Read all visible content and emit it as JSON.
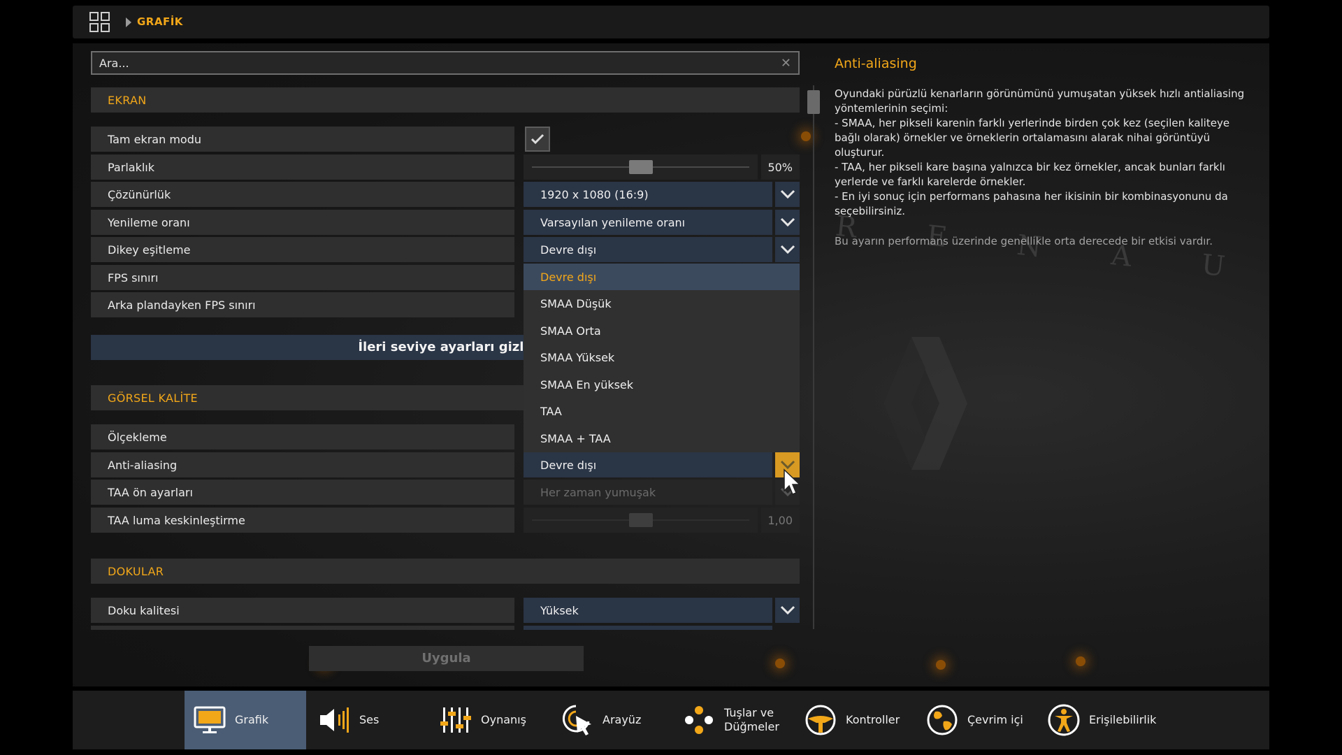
{
  "breadcrumb": {
    "current": "GRAFİK"
  },
  "search": {
    "placeholder": "Ara..."
  },
  "sections": {
    "ekran": "EKRAN",
    "gorsel": "GÖRSEL KALİTE",
    "dokular": "DOKULAR"
  },
  "settings": {
    "fullscreen": {
      "label": "Tam ekran modu",
      "checked": true
    },
    "brightness": {
      "label": "Parlaklık",
      "value": "50%"
    },
    "resolution": {
      "label": "Çözünürlük",
      "value": "1920 x 1080 (16:9)"
    },
    "refresh": {
      "label": "Yenileme oranı",
      "value": "Varsayılan yenileme oranı"
    },
    "vsync": {
      "label": "Dikey eşitleme",
      "value": "Devre dışı"
    },
    "fps_limit": {
      "label": "FPS sınırı"
    },
    "bg_fps_limit": {
      "label": "Arka plandayken FPS sınırı"
    },
    "scaling": {
      "label": "Ölçekleme"
    },
    "antialiasing": {
      "label": "Anti-aliasing",
      "value": "Devre dışı"
    },
    "taa_presets": {
      "label": "TAA ön ayarları",
      "value": "Her zaman yumuşak"
    },
    "taa_sharpen": {
      "label": "TAA luma keskinleştirme",
      "value": "1,00"
    },
    "texture_quality": {
      "label": "Doku kalitesi",
      "value": "Yüksek"
    }
  },
  "advanced_button": "İleri seviye ayarları gizle",
  "apply_button": "Uygula",
  "aa_menu": {
    "options": [
      "Devre dışı",
      "SMAA Düşük",
      "SMAA Orta",
      "SMAA Yüksek",
      "SMAA En yüksek",
      "TAA",
      "SMAA + TAA"
    ],
    "selected": "Devre dışı"
  },
  "description": {
    "title": "Anti-aliasing",
    "lines": [
      "Oyundaki pürüzlü kenarların görünümünü yumuşatan yüksek hızlı antialiasing",
      "yöntemlerinin seçimi:",
      "- SMAA, her pikseli karenin farklı yerlerinde birden çok kez (seçilen kaliteye",
      "bağlı olarak) örnekler ve örneklerin ortalamasını alarak nihai görüntüyü",
      "oluşturur.",
      "- TAA, her pikseli kare başına yalnızca bir kez örnekler, ancak bunları farklı",
      "yerlerde ve farklı karelerde örnekler.",
      "- En iyi sonuç için performans pahasına her ikisinin bir kombinasyonunu da",
      "seçebilirsiniz."
    ],
    "note": "Bu ayarın performans üzerinde genellikle orta derecede bir etkisi vardır."
  },
  "bg_text": "R E N A U",
  "nav": [
    {
      "label": "Grafik",
      "icon": "monitor-icon",
      "active": true
    },
    {
      "label": "Ses",
      "icon": "speaker-icon"
    },
    {
      "label": "Oynanış",
      "icon": "sliders-icon"
    },
    {
      "label": "Arayüz",
      "icon": "cursor-click-icon"
    },
    {
      "label": "Tuşlar ve",
      "label2": "Düğmeler",
      "icon": "buttons-icon"
    },
    {
      "label": "Kontroller",
      "icon": "steering-wheel-icon"
    },
    {
      "label": "Çevrim içi",
      "icon": "globe-icon"
    },
    {
      "label": "Erişilebilirlik",
      "icon": "accessibility-icon"
    }
  ],
  "colors": {
    "accent": "#f2a719",
    "control_bg": "#2a3546",
    "active_tab": "#4b5d75"
  },
  "ui_state": {
    "brightness_level": 0.5,
    "taa_sharpen_level": 0.5
  }
}
